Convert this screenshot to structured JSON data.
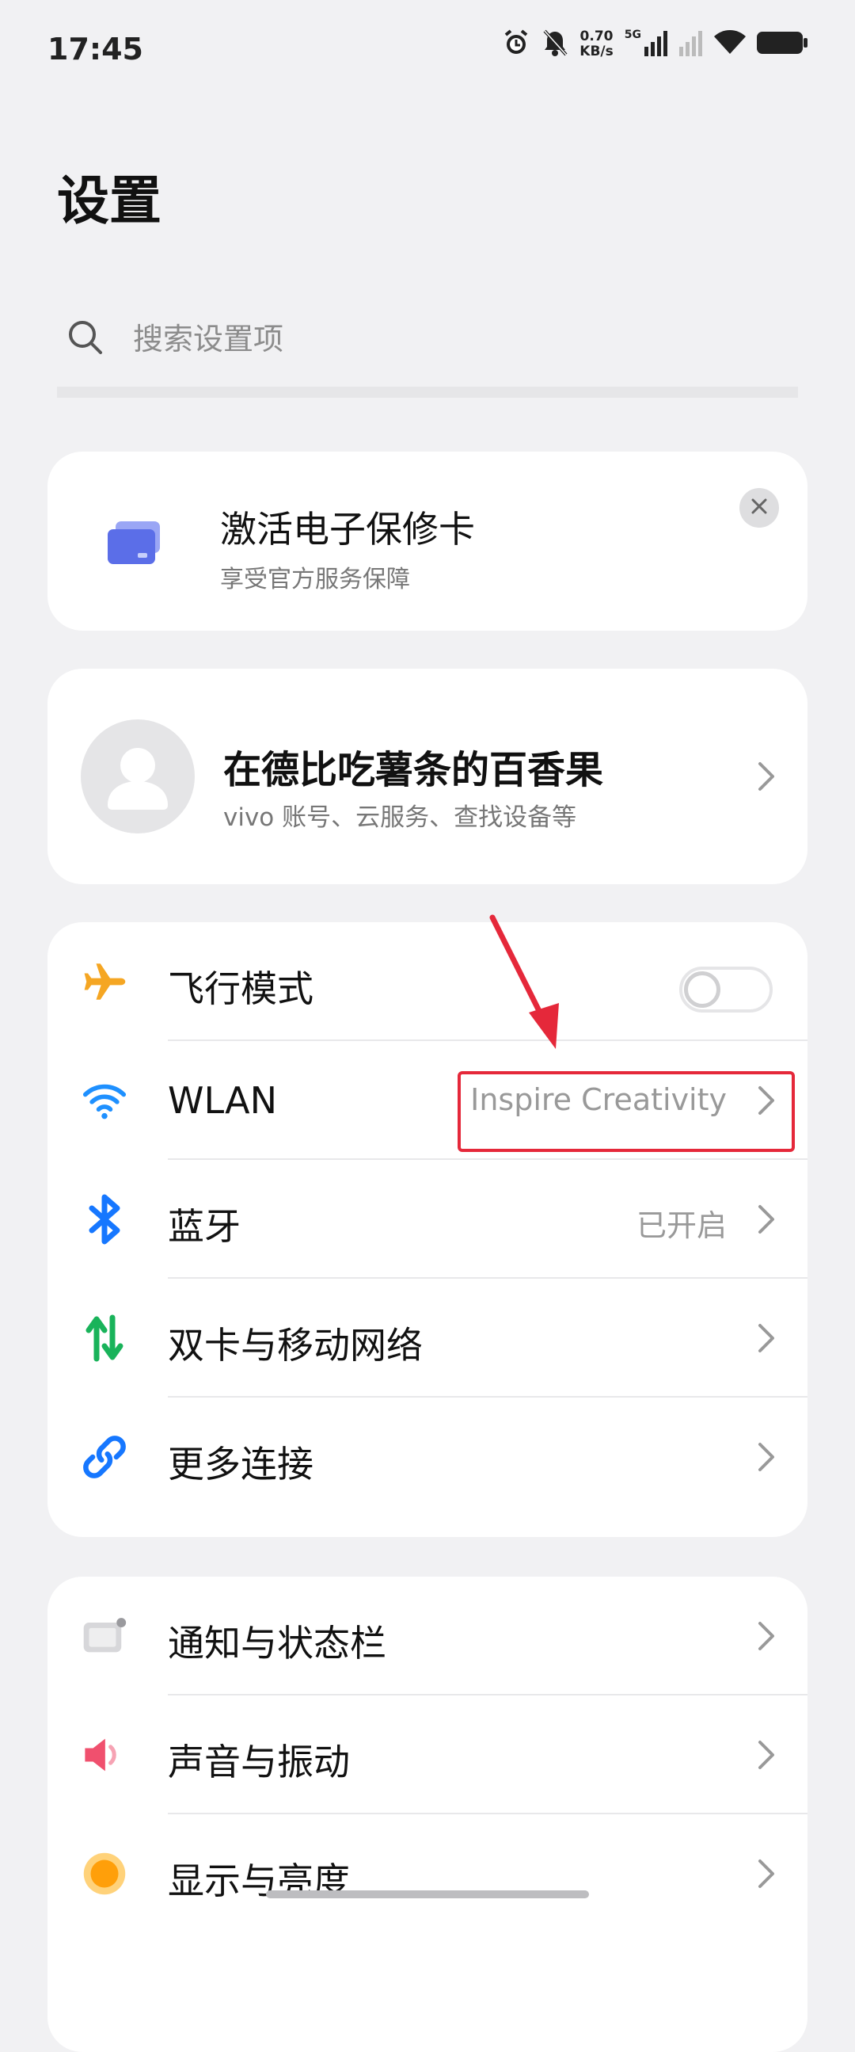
{
  "status_bar": {
    "time": "17:45",
    "speed_value": "0.70",
    "speed_unit": "KB/s",
    "network": "5G"
  },
  "page": {
    "title": "设置"
  },
  "search": {
    "placeholder": "搜索设置项"
  },
  "warranty": {
    "title": "激活电子保修卡",
    "subtitle": "享受官方服务保障"
  },
  "account": {
    "name": "在德比吃薯条的百香果",
    "subtitle": "vivo 账号、云服务、查找设备等"
  },
  "connectivity": [
    {
      "label": "飞行模式",
      "icon": "airplane-icon",
      "toggle": false,
      "value": ""
    },
    {
      "label": "WLAN",
      "icon": "wifi-icon",
      "value": "Inspire Creativity"
    },
    {
      "label": "蓝牙",
      "icon": "bluetooth-icon",
      "value": "已开启"
    },
    {
      "label": "双卡与移动网络",
      "icon": "mobile-network-icon",
      "value": ""
    },
    {
      "label": "更多连接",
      "icon": "link-icon",
      "value": ""
    }
  ],
  "system": [
    {
      "label": "通知与状态栏",
      "icon": "notification-icon"
    },
    {
      "label": "声音与振动",
      "icon": "sound-icon"
    },
    {
      "label": "显示与亮度",
      "icon": "display-icon"
    }
  ],
  "colors": {
    "background": "#f1f1f3",
    "airplane": "#f5a623",
    "wifi": "#1e90ff",
    "bluetooth": "#1677ff",
    "mobile_up": "#19b35a",
    "mobile_down": "#19b35a",
    "annotation": "#e5283a"
  }
}
